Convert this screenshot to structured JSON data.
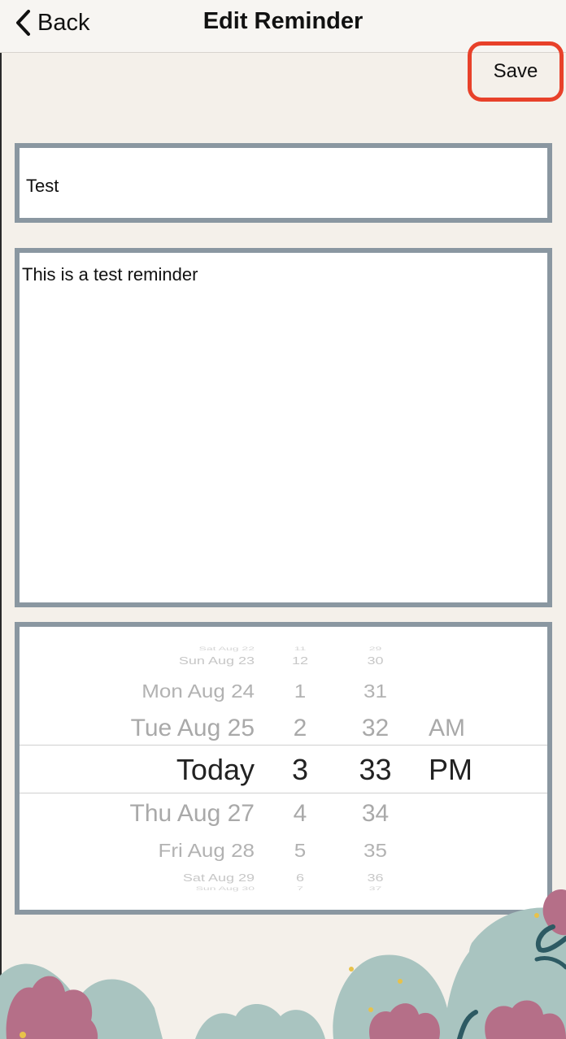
{
  "nav": {
    "back_label": "Back",
    "title": "Edit Reminder"
  },
  "toolbar": {
    "save_label": "Save"
  },
  "form": {
    "title_value": "Test",
    "body_value": "This is a test reminder"
  },
  "picker": {
    "dates": [
      "Sat Aug 22",
      "Sun Aug 23",
      "Mon Aug 24",
      "Tue Aug 25",
      "Today",
      "Thu Aug 27",
      "Fri Aug 28",
      "Sat Aug 29",
      "Sun Aug 30"
    ],
    "hours": [
      "11",
      "12",
      "1",
      "2",
      "3",
      "4",
      "5",
      "6",
      "7"
    ],
    "minutes": [
      "29",
      "30",
      "31",
      "32",
      "33",
      "34",
      "35",
      "36",
      "37"
    ],
    "ampm": [
      "AM",
      "PM"
    ],
    "selected": {
      "date": "Today",
      "hour": "3",
      "minute": "33",
      "ampm": "PM"
    }
  },
  "colors": {
    "background": "#f4f0ea",
    "field_border": "#8a97a1",
    "save_highlight": "#e8412a",
    "flower_pink": "#b56f88",
    "leaf_teal": "#a9c4c0",
    "leaf_dark": "#2d5a63",
    "dot_yellow": "#e8c24a"
  }
}
